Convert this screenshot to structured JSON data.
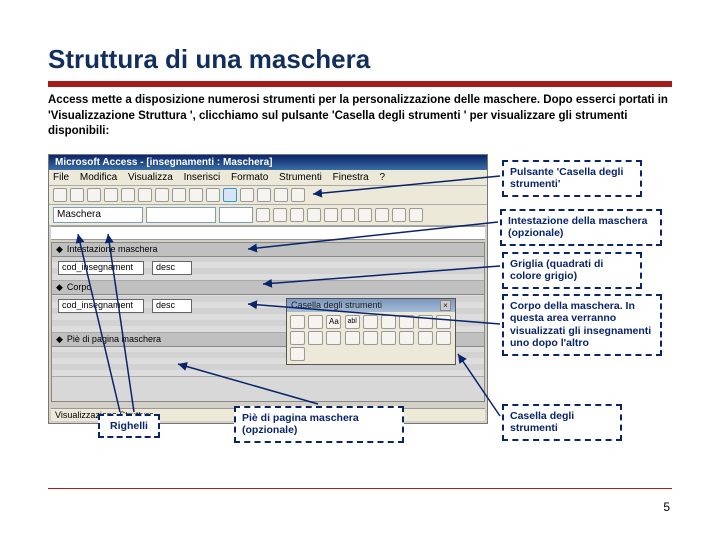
{
  "title": "Struttura di una maschera",
  "intro": "Access mette a disposizione numerosi strumenti per la personalizzazione delle maschere. Dopo esserci portati in 'Visualizzazione Struttura ', clicchiamo sul pulsante 'Casella degli strumenti ' per visualizzare gli strumenti disponibili:",
  "window": {
    "title": "Microsoft Access - [insegnamenti : Maschera]",
    "menu": [
      "File",
      "Modifica",
      "Visualizza",
      "Inserisci",
      "Formato",
      "Strumenti",
      "Finestra",
      "?"
    ],
    "combo_label": "Maschera",
    "sections": {
      "header": "Intestazione maschera",
      "body": "Corpo",
      "footer": "Piè di pagina maschera"
    },
    "fields": {
      "f1_label": "cod_insegnament",
      "f1_val": "desc",
      "f2_label": "cod_insegnament",
      "f2_val": "desc"
    },
    "status": "Visualizzazione Struttura"
  },
  "toolbox": {
    "title": "Casella degli strumenti",
    "icons": [
      "pointer",
      "wizard",
      "label",
      "textbox",
      "optiongroup",
      "toggle",
      "option",
      "checkbox",
      "combo",
      "listbox",
      "button",
      "image",
      "unbound",
      "bound",
      "pagebreak",
      "tab",
      "subform",
      "line",
      "rect"
    ],
    "sample_glyphs": [
      "Aa",
      "abl"
    ]
  },
  "callouts": {
    "c1": "Pulsante 'Casella degli strumenti'",
    "c2": "Intestazione della maschera (opzionale)",
    "c3": "Griglia (quadrati di colore grigio)",
    "c4": "Corpo della maschera. In questa area verranno visualizzati gli insegnamenti uno dopo l'altro",
    "c5": "Casella degli strumenti",
    "c6": "Piè di pagina maschera (opzionale)",
    "c7": "Righelli"
  },
  "page_number": "5"
}
